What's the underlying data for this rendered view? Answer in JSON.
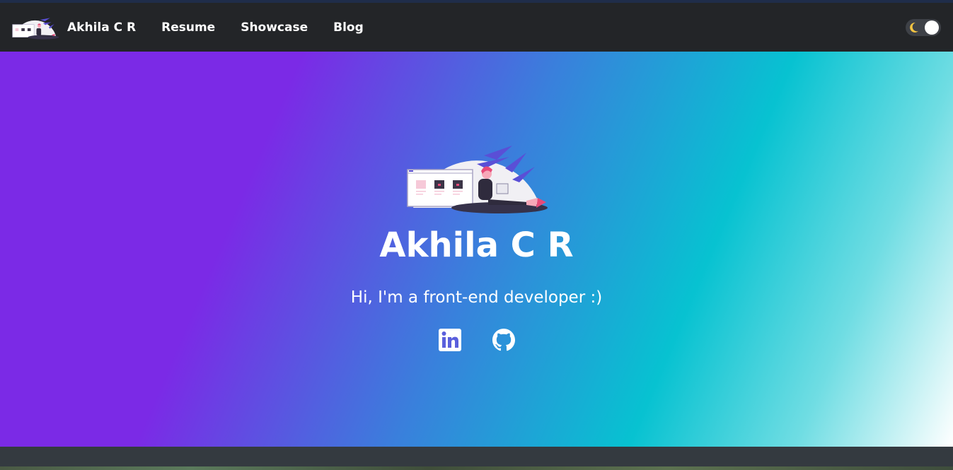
{
  "nav": {
    "brand_name": "Akhila C R",
    "links": [
      {
        "label": "Resume"
      },
      {
        "label": "Showcase"
      },
      {
        "label": "Blog"
      }
    ],
    "theme_toggle": {
      "icon": "moon-icon",
      "state": "on"
    }
  },
  "hero": {
    "title": "Akhila C R",
    "subtitle": "Hi, I'm a front-end developer :)",
    "social": [
      {
        "icon": "linkedin-icon"
      },
      {
        "icon": "github-icon"
      }
    ]
  },
  "colors": {
    "navbar_bg": "#232528",
    "gradient_start": "#7b2ae6",
    "gradient_mid": "#07c2d1",
    "gradient_end": "#ffffff",
    "footer_bg": "#343a40"
  }
}
